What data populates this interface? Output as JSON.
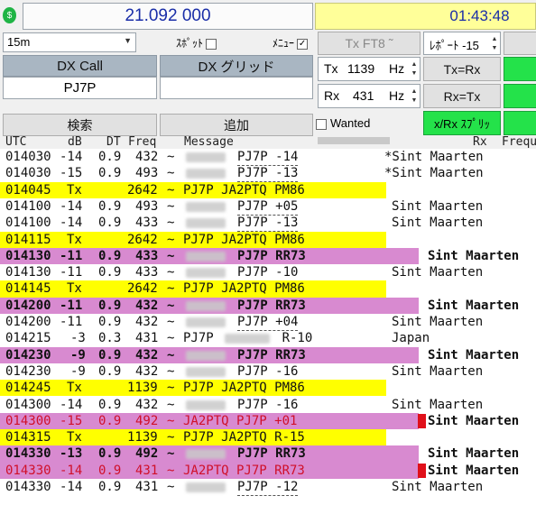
{
  "top": {
    "indicator": "$",
    "dial_freq": "21.092 000",
    "clock": "01:43:48",
    "band": "15m",
    "spot_label": "ｽﾎﾟｯﾄ",
    "menu_label": "ﾒﾆｭｰ",
    "menu_checked_mark": "✓",
    "mode": "Tx FT8",
    "report": "ﾚﾎﾟｰﾄ -15",
    "dx_call_header": "DX Call",
    "dx_grid_header": "DX グリッド",
    "dx_call_value": "PJ7P",
    "dx_grid_value": "",
    "tx_label": "Tx",
    "tx_value": "1139",
    "tx_unit": "Hz",
    "rx_label": "Rx",
    "rx_value": "431",
    "rx_unit": "Hz",
    "tx_eq_rx": "Tx=Rx",
    "rx_eq_tx": "Rx=Tx",
    "search": "検索",
    "add": "追加",
    "wanted": "Wanted",
    "split": "x/Rx ｽﾌﾟﾘｯ"
  },
  "columns": {
    "utc": "UTC",
    "db": "dB",
    "dt": "DT",
    "freq": "Freq",
    "message": "Message",
    "rx": "Rx",
    "freq2": "Frequ"
  },
  "colors": {
    "yellow": "#ffff00",
    "pink": "#d88ad0",
    "red_text": "#d0102a",
    "flag": "#e0101a"
  },
  "rows": [
    {
      "utc": "014030",
      "db": "-14",
      "dt": "0.9",
      "freq": "432",
      "sym": "~",
      "msg": "PJ7P -14",
      "country": "*Sint Maarten",
      "style": "normal",
      "blur": true
    },
    {
      "utc": "014030",
      "db": "-15",
      "dt": "0.9",
      "freq": "493",
      "sym": "~",
      "msg": "PJ7P -13",
      "country": "*Sint Maarten",
      "style": "normal",
      "blur": true
    },
    {
      "utc": "014045",
      "db": "Tx",
      "dt": "",
      "freq": "2642",
      "sym": "~",
      "msg": "PJ7P JA2PTQ PM86",
      "country": "",
      "style": "tx",
      "blur": false
    },
    {
      "utc": "014100",
      "db": "-14",
      "dt": "0.9",
      "freq": "493",
      "sym": "~",
      "msg": "PJ7P +05",
      "country": "Sint Maarten",
      "style": "normal",
      "blur": true
    },
    {
      "utc": "014100",
      "db": "-14",
      "dt": "0.9",
      "freq": "433",
      "sym": "~",
      "msg": "PJ7P -13",
      "country": "Sint Maarten",
      "style": "normal",
      "blur": true
    },
    {
      "utc": "014115",
      "db": "Tx",
      "dt": "",
      "freq": "2642",
      "sym": "~",
      "msg": "PJ7P JA2PTQ PM86",
      "country": "",
      "style": "tx",
      "blur": false
    },
    {
      "utc": "014130",
      "db": "-11",
      "dt": "0.9",
      "freq": "433",
      "sym": "~",
      "msg": "PJ7P RR73",
      "country": "Sint Maarten",
      "style": "pink",
      "blur": true
    },
    {
      "utc": "014130",
      "db": "-11",
      "dt": "0.9",
      "freq": "433",
      "sym": "~",
      "msg": "PJ7P -10",
      "country": "Sint Maarten",
      "style": "normal",
      "blur": true
    },
    {
      "utc": "014145",
      "db": "Tx",
      "dt": "",
      "freq": "2642",
      "sym": "~",
      "msg": "PJ7P JA2PTQ PM86",
      "country": "",
      "style": "tx",
      "blur": false
    },
    {
      "utc": "014200",
      "db": "-11",
      "dt": "0.9",
      "freq": "432",
      "sym": "~",
      "msg": "PJ7P RR73",
      "country": "Sint Maarten",
      "style": "pink",
      "blur": true
    },
    {
      "utc": "014200",
      "db": "-11",
      "dt": "0.9",
      "freq": "432",
      "sym": "~",
      "msg": "PJ7P +04",
      "country": "Sint Maarten",
      "style": "normal",
      "blur": true
    },
    {
      "utc": "014215",
      "db": "-3",
      "dt": "0.3",
      "freq": "431",
      "sym": "~",
      "msg": "PJ7P         R-10",
      "country": "Japan",
      "style": "normal",
      "blur": false,
      "blur2": true
    },
    {
      "utc": "014230",
      "db": "-9",
      "dt": "0.9",
      "freq": "432",
      "sym": "~",
      "msg": "PJ7P RR73",
      "country": "Sint Maarten",
      "style": "pink",
      "blur": true
    },
    {
      "utc": "014230",
      "db": "-9",
      "dt": "0.9",
      "freq": "432",
      "sym": "~",
      "msg": "PJ7P -16",
      "country": "Sint Maarten",
      "style": "normal",
      "blur": true
    },
    {
      "utc": "014245",
      "db": "Tx",
      "dt": "",
      "freq": "1139",
      "sym": "~",
      "msg": "PJ7P JA2PTQ PM86",
      "country": "",
      "style": "tx",
      "blur": false
    },
    {
      "utc": "014300",
      "db": "-14",
      "dt": "0.9",
      "freq": "432",
      "sym": "~",
      "msg": "PJ7P -16",
      "country": "Sint Maarten",
      "style": "normal",
      "blur": true
    },
    {
      "utc": "014300",
      "db": "-15",
      "dt": "0.9",
      "freq": "492",
      "sym": "~",
      "msg": "JA2PTQ PJ7P +01",
      "country": "Sint Maarten",
      "style": "pinkred",
      "blur": false
    },
    {
      "utc": "014315",
      "db": "Tx",
      "dt": "",
      "freq": "1139",
      "sym": "~",
      "msg": "PJ7P JA2PTQ R-15",
      "country": "",
      "style": "tx",
      "blur": false
    },
    {
      "utc": "014330",
      "db": "-13",
      "dt": "0.9",
      "freq": "492",
      "sym": "~",
      "msg": "PJ7P RR73",
      "country": "Sint Maarten",
      "style": "pink",
      "blur": true
    },
    {
      "utc": "014330",
      "db": "-14",
      "dt": "0.9",
      "freq": "431",
      "sym": "~",
      "msg": "JA2PTQ PJ7P RR73",
      "country": "Sint Maarten",
      "style": "pinkred",
      "blur": false
    },
    {
      "utc": "014330",
      "db": "-14",
      "dt": "0.9",
      "freq": "431",
      "sym": "~",
      "msg": "PJ7P -12",
      "country": "Sint Maarten",
      "style": "normal",
      "blur": true
    }
  ]
}
